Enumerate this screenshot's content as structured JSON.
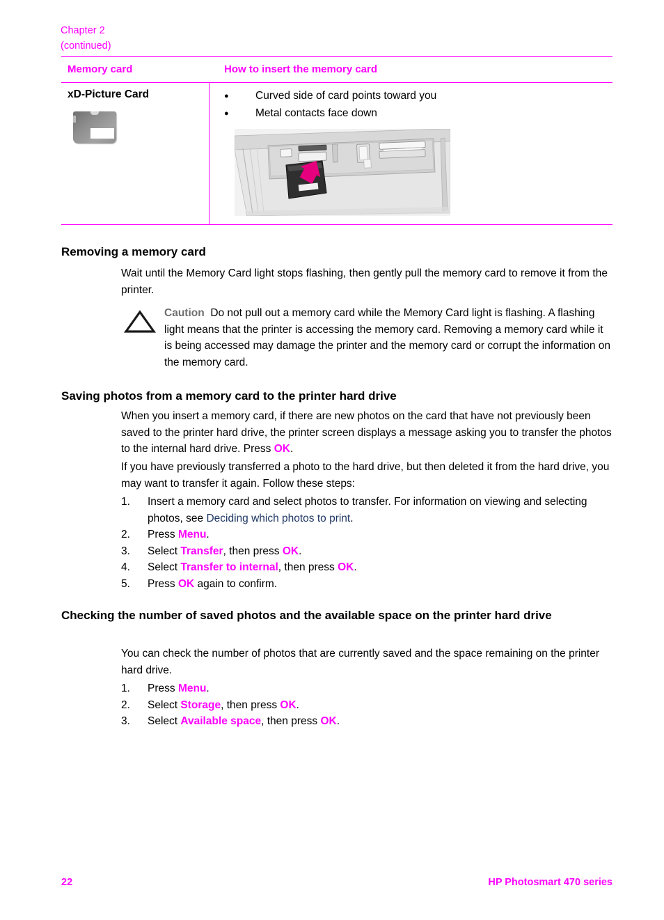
{
  "header": {
    "chapter": "Chapter 2",
    "continued": "(continued)"
  },
  "table": {
    "columns": [
      "Memory card",
      "How to insert the memory card"
    ],
    "row": {
      "card_name": "xD-Picture Card",
      "card_image_name": "xd-picture-card-photo",
      "instructions": [
        "Curved side of card points toward you",
        "Metal contacts face down"
      ],
      "illustration_name": "printer-card-slot-illustration"
    }
  },
  "sections": [
    {
      "heading": "Removing a memory card",
      "paragraph": "Wait until the Memory Card light stops flashing, then gently pull the memory card to remove it from the printer."
    },
    {
      "heading": "Saving photos from a memory card to the printer hard drive",
      "paragraph_1_a": "When you insert a memory card, if there are new photos on the card that have not previously been saved to the printer hard drive, the printer screen displays a message asking you to transfer the photos to the internal hard drive. Press ",
      "paragraph_1_ok": "OK",
      "paragraph_1_b": ".",
      "paragraph_2": "If you have previously transferred a photo to the hard drive, but then deleted it from the hard drive, you may want to transfer it again. Follow these steps:"
    },
    {
      "heading": "Checking the number of saved photos and the available space on the printer hard drive",
      "paragraph": "You can check the number of photos that are currently saved and the space remaining on the printer hard drive."
    }
  ],
  "caution": {
    "icon_name": "caution-triangle-icon",
    "label": "Caution",
    "text": "Do not pull out a memory card while the Memory Card light is flashing. A flashing light means that the printer is accessing the memory card. Removing a memory card while it is being accessed may damage the printer and the memory card or corrupt the information on the memory card."
  },
  "transfer_steps": [
    {
      "num": "1.",
      "pre": "Insert a memory card and select photos to transfer. For information on viewing and selecting photos, see ",
      "link": "Deciding which photos to print",
      "post": "."
    },
    {
      "num": "2.",
      "pre": "Press ",
      "key": "Menu",
      "post": "."
    },
    {
      "num": "3.",
      "pre": "Select ",
      "key": "Transfer",
      "mid": ", then press ",
      "key2": "OK",
      "post": "."
    },
    {
      "num": "4.",
      "pre": "Select ",
      "key": "Transfer to internal",
      "mid": ", then press ",
      "key2": "OK",
      "post": "."
    },
    {
      "num": "5.",
      "pre": "Press ",
      "key": "OK",
      "post": " again to confirm."
    }
  ],
  "storage_steps": [
    {
      "num": "1.",
      "pre": "Press ",
      "key": "Menu",
      "post": "."
    },
    {
      "num": "2.",
      "pre": "Select ",
      "key": "Storage",
      "mid": ", then press ",
      "key2": "OK",
      "post": "."
    },
    {
      "num": "3.",
      "pre": "Select ",
      "key": "Available space",
      "mid": ", then press ",
      "key2": "OK",
      "post": "."
    }
  ],
  "footer": {
    "page_number": "22",
    "product": "HP Photosmart 470 series"
  },
  "colors": {
    "accent_magenta": "#FF00FF",
    "link_blue": "#1F3864",
    "caution_gray": "#6F6F6F"
  }
}
